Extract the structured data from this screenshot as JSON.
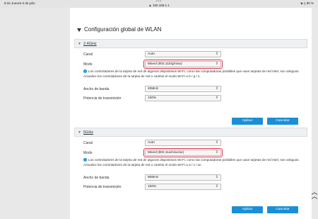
{
  "statusbar": {
    "time": "8:34  Jueves 6 de julio",
    "dots": "•••",
    "url": "▲ 192.168.1.1",
    "right": "◈ ▯ 80 %"
  },
  "section": {
    "title": "Configuración global de WLAN"
  },
  "band24": {
    "label": "2.4GHz",
    "canal_label": "Canal",
    "canal_value": "Auto",
    "modo_label": "Modo",
    "modo_value": "Mixed (802.11b/g/n/ax)",
    "info": "Los controladores de la tarjeta de red de algunos dispositivos Wi-Fi, como las computadoras portátiles que usan tarjetas de red Intel, son antiguos. Actualice los controladores de la tarjeta de red o cambie el modo Wi-Fi a b / g / n.",
    "ancho_label": "Ancho de banda",
    "ancho_value": "20MHz",
    "potencia_label": "Potencia de transmisión",
    "potencia_value": "100%",
    "apply": "Aplicar",
    "cancel": "Cancelar"
  },
  "band5": {
    "label": "5GHz",
    "canal_label": "Canal",
    "canal_value": "Auto",
    "modo_label": "Modo",
    "modo_value": "Mixed (802.11a/n/ac/ax)",
    "info": "Los controladores de la tarjeta de red de algunos dispositivos Wi-Fi, como las computadoras portátiles que usan tarjetas de red Intel, son antiguos. Actualice los controladores de la tarjeta de red o cambie el modo Wi-Fi a a / n / ac.",
    "ancho_label": "Ancho de banda",
    "ancho_value": "80MHz",
    "potencia_label": "Potencia de transmisión",
    "potencia_value": "100%",
    "apply": "Aplicar",
    "cancel": "Cancelar"
  },
  "colors": {
    "accent": "#1a8fd6",
    "highlight": "#e0314a"
  },
  "icons": {
    "info": "info-icon",
    "collapse": "triangle-down-icon",
    "scroll": "double-chevron-up-icon"
  }
}
